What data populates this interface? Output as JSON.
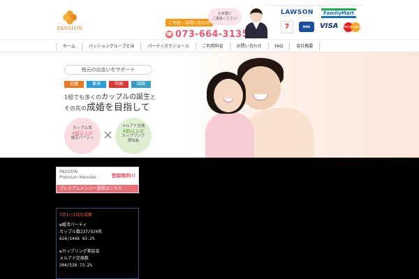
{
  "header": {
    "topline": "＿＿＿＿＿＿＿＿＿＿＿＿＿＿＿＿＿＿＿＿＿＿＿＿＿＿＿＿",
    "logo_text": "PASSION",
    "contact_label": "ご予約・お問い合わせ",
    "phone": "073-664-3135",
    "bubble_text": "お気軽に\nご連絡ください!",
    "brands": {
      "lawson": "LAWSON",
      "familymart": "FamilyMart",
      "seven": "7",
      "ministop": "MINI STOP",
      "visa": "VISA",
      "mastercard": "MasterCard"
    }
  },
  "nav": {
    "items": [
      "ホーム",
      "パッショングループとは",
      "パーティスケジュール",
      "ご利用料金",
      "お問い合わせ",
      "FAQ",
      "会社概要"
    ]
  },
  "hero": {
    "tagline": "地元の出会いをサポート",
    "regions": [
      "近畿",
      "東海",
      "中国",
      "四国"
    ],
    "copy1_pre": "1組でも多くの",
    "copy1_accent": "カップルの誕生",
    "copy1_post": "と",
    "copy2_pre": "その先の",
    "copy2_accent": "成婚を目指して",
    "circle_left": {
      "line1": "カップル率",
      "big": "4割以上の",
      "line3": "婚活パーティ"
    },
    "circle_right": {
      "line1": "メルアド交換",
      "big": "8割以上の",
      "line3": "カップリング",
      "line4": "茶話会"
    },
    "cross": "×"
  },
  "member": {
    "title_line1": "PASSION",
    "title_line2": "Premium Member",
    "free": "登録無料!!",
    "link": "プレミアムメンバー登録はこちら"
  },
  "stats": {
    "heading": "7月1〜2日の成績",
    "block1_title": "✿婚活パーティ",
    "block1_line1": "カップル数237/524名",
    "block1_line2": "624/1448 43.2%",
    "block2_title": "✿カップリング茶話会",
    "block2_line1": "メルアド交換数",
    "block2_line2": "304/538 73.2%"
  },
  "colors": {
    "accent_pink": "#e85a6a",
    "orange": "#f29b1a",
    "dark_bg": "#000000"
  }
}
